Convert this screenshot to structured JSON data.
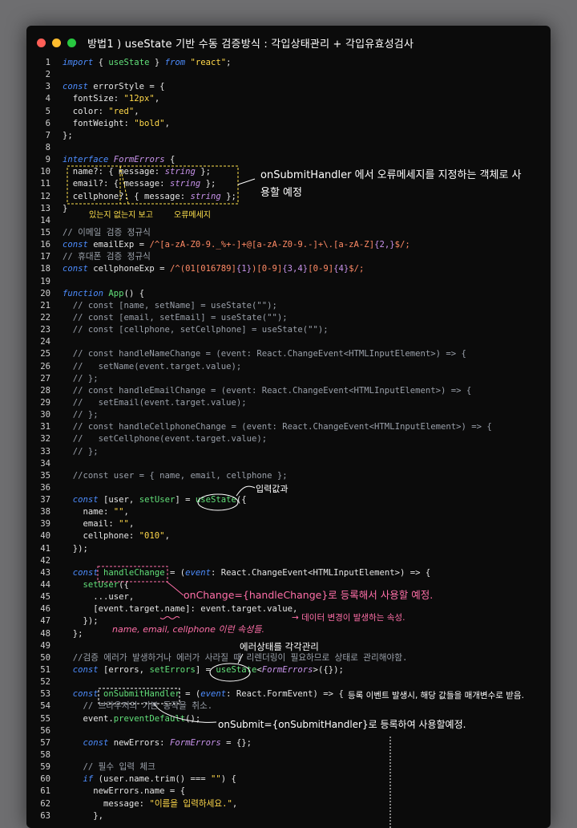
{
  "window": {
    "title": "방법1 ) useState 기반 수동 검증방식 : 각입상태관리 + 각입유효성검사",
    "traffic_lights": {
      "close": "#ff5f57",
      "minimize": "#febc2e",
      "maximize": "#28c840"
    }
  },
  "code": {
    "lines": [
      {
        "n": "1",
        "t": "import { useState } from \"react\";"
      },
      {
        "n": "2",
        "t": ""
      },
      {
        "n": "3",
        "t": "const errorStyle = {"
      },
      {
        "n": "4",
        "t": "  fontSize: \"12px\","
      },
      {
        "n": "5",
        "t": "  color: \"red\","
      },
      {
        "n": "6",
        "t": "  fontWeight: \"bold\","
      },
      {
        "n": "7",
        "t": "};"
      },
      {
        "n": "8",
        "t": ""
      },
      {
        "n": "9",
        "t": "interface FormErrors {"
      },
      {
        "n": "10",
        "t": "  name?: { message: string };"
      },
      {
        "n": "11",
        "t": "  email?: { message: string };"
      },
      {
        "n": "12",
        "t": "  cellphone?: { message: string };"
      },
      {
        "n": "13",
        "t": "}"
      },
      {
        "n": "14",
        "t": ""
      },
      {
        "n": "15",
        "t": "// 이메일 검증 정규식"
      },
      {
        "n": "16",
        "t": "const emailExp = /^[a-zA-Z0-9._%+-]+@[a-zA-Z0-9.-]+\\.[a-zA-Z]{2,}$/;"
      },
      {
        "n": "17",
        "t": "// 휴대폰 검증 정규식"
      },
      {
        "n": "18",
        "t": "const cellphoneExp = /^(01[016789]{1})[0-9]{3,4}[0-9]{4}$/;"
      },
      {
        "n": "19",
        "t": ""
      },
      {
        "n": "20",
        "t": "function App() {"
      },
      {
        "n": "21",
        "t": "  // const [name, setName] = useState(\"\");"
      },
      {
        "n": "22",
        "t": "  // const [email, setEmail] = useState(\"\");"
      },
      {
        "n": "23",
        "t": "  // const [cellphone, setCellphone] = useState(\"\");"
      },
      {
        "n": "24",
        "t": ""
      },
      {
        "n": "25",
        "t": "  // const handleNameChange = (event: React.ChangeEvent<HTMLInputElement>) => {"
      },
      {
        "n": "26",
        "t": "  //   setName(event.target.value);"
      },
      {
        "n": "27",
        "t": "  // };"
      },
      {
        "n": "28",
        "t": "  // const handleEmailChange = (event: React.ChangeEvent<HTMLInputElement>) => {"
      },
      {
        "n": "29",
        "t": "  //   setEmail(event.target.value);"
      },
      {
        "n": "30",
        "t": "  // };"
      },
      {
        "n": "31",
        "t": "  // const handleCellphoneChange = (event: React.ChangeEvent<HTMLInputElement>) => {"
      },
      {
        "n": "32",
        "t": "  //   setCellphone(event.target.value);"
      },
      {
        "n": "33",
        "t": "  // };"
      },
      {
        "n": "34",
        "t": ""
      },
      {
        "n": "35",
        "t": "  //const user = { name, email, cellphone };"
      },
      {
        "n": "36",
        "t": ""
      },
      {
        "n": "37",
        "t": "  const [user, setUser] = useState({"
      },
      {
        "n": "38",
        "t": "    name: \"\","
      },
      {
        "n": "39",
        "t": "    email: \"\","
      },
      {
        "n": "40",
        "t": "    cellphone: \"010\","
      },
      {
        "n": "41",
        "t": "  });"
      },
      {
        "n": "42",
        "t": ""
      },
      {
        "n": "43",
        "t": "  const handleChange = (event: React.ChangeEvent<HTMLInputElement>) => {"
      },
      {
        "n": "44",
        "t": "    setUser({"
      },
      {
        "n": "45",
        "t": "      ...user,"
      },
      {
        "n": "46",
        "t": "      [event.target.name]: event.target.value,"
      },
      {
        "n": "47",
        "t": "    });"
      },
      {
        "n": "48",
        "t": "  };"
      },
      {
        "n": "49",
        "t": ""
      },
      {
        "n": "50",
        "t": "  //검증 에러가 발생하거나 에러가 사라질 때 리렌더링이 필요하므로 상태로 관리해야함."
      },
      {
        "n": "51",
        "t": "  const [errors, setErrors] = useState<FormErrors>({});"
      },
      {
        "n": "52",
        "t": ""
      },
      {
        "n": "53",
        "t": "  const onSubmitHandler = (event: React.FormEvent) => {"
      },
      {
        "n": "54",
        "t": "    // 브라우저의 기본 동작을 취소."
      },
      {
        "n": "55",
        "t": "    event.preventDefault();"
      },
      {
        "n": "56",
        "t": ""
      },
      {
        "n": "57",
        "t": "    const newErrors: FormErrors = {};"
      },
      {
        "n": "58",
        "t": ""
      },
      {
        "n": "59",
        "t": "    // 필수 입력 체크"
      },
      {
        "n": "60",
        "t": "    if (user.name.trim() === \"\") {"
      },
      {
        "n": "61",
        "t": "      newErrors.name = {"
      },
      {
        "n": "62",
        "t": "        message: \"이름을 입력하세요.\","
      },
      {
        "n": "63",
        "t": "      },"
      }
    ]
  },
  "annotations": {
    "interface_note": "onSubmitHandler 에서 오류메세지를 지정하는 객체로 사용할 예정",
    "optional_note": "있는지 없는지 보고",
    "error_message_note": "오류메세지",
    "input_value_note": "입력값과",
    "onchange_note": "onChange={handleChange}로 등록해서 사용할 예정.",
    "data_change_note": "→ 데이터 변경이 발생하는 속성.",
    "name_attr_note": "name, email, cellphone 이런 속성들.",
    "error_state_note": "에러상태를 각각관리",
    "submit_event_note": "등록 이벤트 발생시, 해당 값들을 매개변수로 받음.",
    "onsubmit_note": "onSubmit={onSubmitHandler}로 등록하여 사용할예정."
  },
  "colors": {
    "keyword": "#4d8dff",
    "string": "#ffd84a",
    "type": "#c792ea",
    "function": "#62e07a",
    "comment": "#9aa0aa",
    "annotation_white": "#ffffff",
    "annotation_pink": "#ff6fa8",
    "annotation_yellow": "#ffe14d"
  }
}
